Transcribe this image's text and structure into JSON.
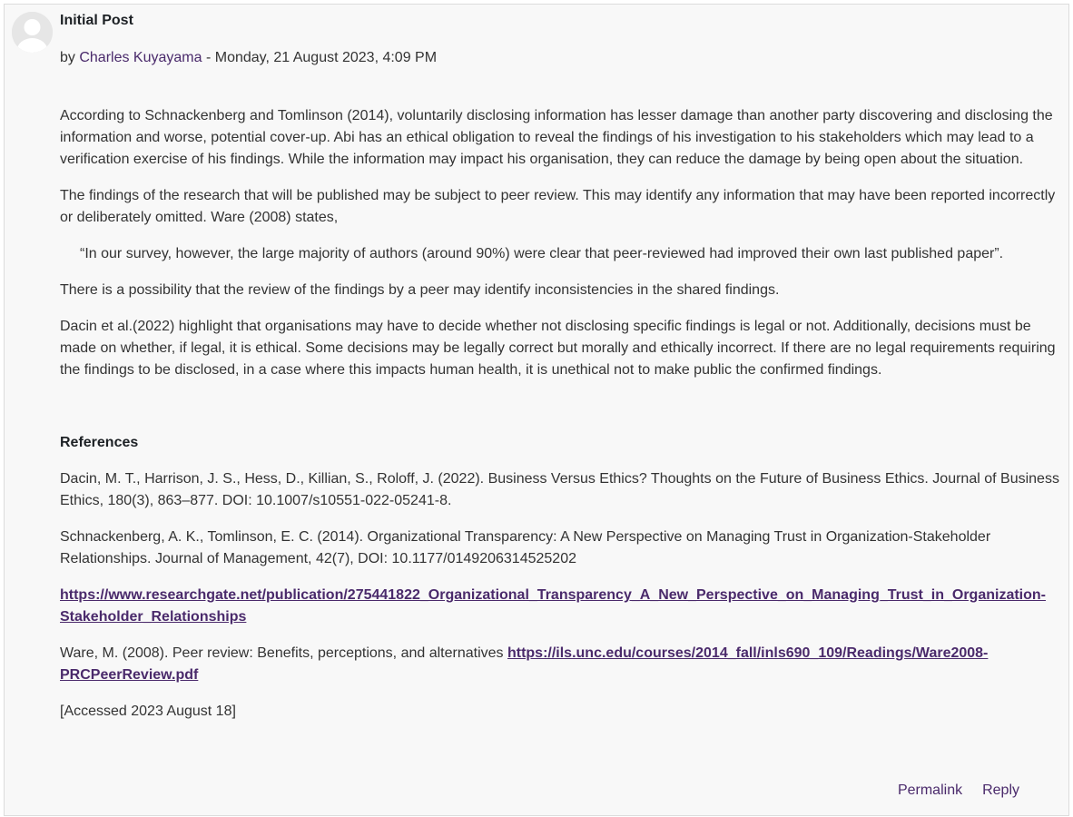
{
  "post": {
    "subject": "Initial Post",
    "byline_prefix": "by ",
    "author": "Charles Kuyayama",
    "byline_suffix": " - Monday, 21 August 2023, 4:09 PM",
    "paragraphs": [
      "According to Schnackenberg and Tomlinson (2014), voluntarily disclosing information has lesser damage than another party discovering and disclosing the information and worse, potential cover-up. Abi has an ethical obligation to reveal the findings of his investigation to his stakeholders which may lead to a verification exercise of his findings. While the information may impact his organisation, they can reduce the damage by being open about the situation.",
      "The findings of the research that will be published may be subject to peer review. This may identify any information that may have been reported incorrectly or deliberately omitted. Ware (2008) states,",
      "“In our survey, however, the large majority of authors (around 90%) were clear that peer-reviewed had improved their own last published paper”.",
      "There is a possibility that the review of the findings by a peer may identify inconsistencies in the shared findings.",
      "Dacin et al.(2022) highlight that organisations may have to decide whether not disclosing specific findings is legal or not. Additionally, decisions must be made on whether, if legal, it is ethical. Some decisions may be legally correct but morally and ethically incorrect. If there are no legal requirements requiring the findings to be disclosed, in a case where this impacts human health, it is unethical not to make public the confirmed findings."
    ],
    "references_title": "References",
    "references": {
      "dacin": "Dacin, M. T., Harrison, J. S., Hess, D., Killian, S., Roloff, J. (2022). Business Versus Ethics? Thoughts on the Future of Business Ethics. Journal of Business Ethics, 180(3), 863–877. DOI: 10.1007/s10551-022-05241-8.",
      "schnackenberg": "Schnackenberg, A. K.,  Tomlinson, E. C. (2014). Organizational Transparency: A New Perspective on Managing Trust in Organization-Stakeholder Relationships. Journal of Management, 42(7), DOI: 10.1177/0149206314525202",
      "researchgate_link": "https://www.researchgate.net/publication/275441822_Organizational_Transparency_A_New_Perspective_on_Managing_Trust_in_Organization-Stakeholder_Relationships",
      "ware_text": "Ware, M. (2008). Peer review: Benefits, perceptions, and alternatives ",
      "ware_link": "https://ils.unc.edu/courses/2014_fall/inls690_109/Readings/Ware2008-PRCPeerReview.pdf",
      "accessed": "[Accessed 2023 August 18]"
    },
    "actions": {
      "permalink": "Permalink",
      "reply": "Reply"
    }
  },
  "colors": {
    "background": "#f8f8f8",
    "link": "#4a2a6b",
    "text": "#333333"
  }
}
